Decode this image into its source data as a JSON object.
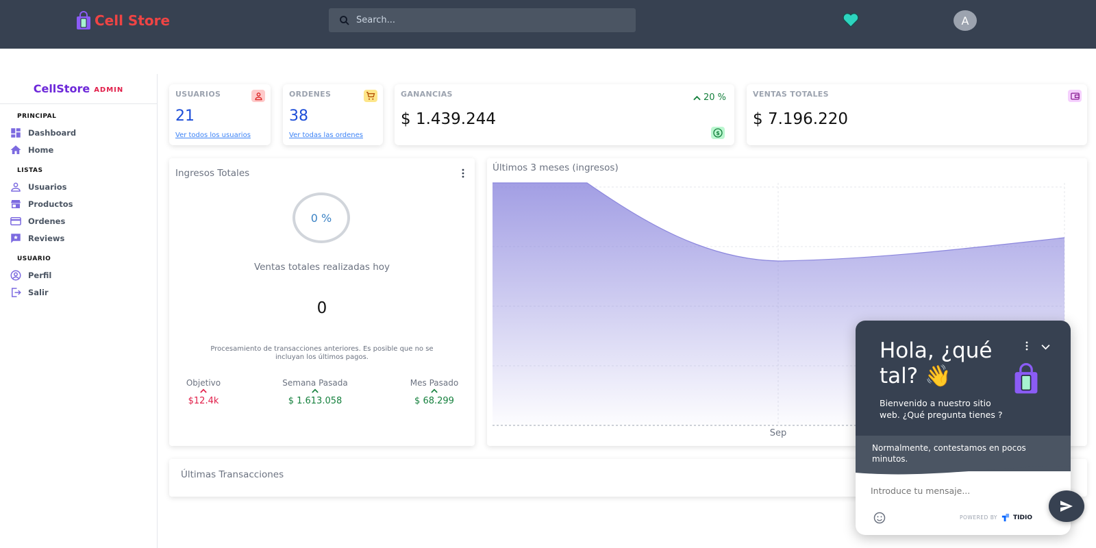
{
  "header": {
    "brand": "Cell Store",
    "search_placeholder": "Search...",
    "avatar_initial": "A"
  },
  "sidebar": {
    "title": "CellStore",
    "title_badge": "ADMIN",
    "sections": [
      {
        "label": "PRINCIPAL",
        "items": [
          {
            "label": "Dashboard",
            "icon": "dashboard-icon"
          },
          {
            "label": "Home",
            "icon": "home-icon"
          }
        ]
      },
      {
        "label": "LISTAS",
        "items": [
          {
            "label": "Usuarios",
            "icon": "user-icon"
          },
          {
            "label": "Productos",
            "icon": "store-icon"
          },
          {
            "label": "Ordenes",
            "icon": "credit-card-icon"
          },
          {
            "label": "Reviews",
            "icon": "review-icon"
          }
        ]
      },
      {
        "label": "USUARIO",
        "items": [
          {
            "label": "Perfil",
            "icon": "account-circle-icon"
          },
          {
            "label": "Salir",
            "icon": "logout-icon"
          }
        ]
      }
    ]
  },
  "stats": {
    "usuarios": {
      "label": "USUARIOS",
      "value": "21",
      "link": "Ver todos los usuarios"
    },
    "ordenes": {
      "label": "ORDENES",
      "value": "38",
      "link": "Ver todas las ordenes"
    },
    "ganancias": {
      "label": "GANANCIAS",
      "value": "$ 1.439.244",
      "percent": "20 %"
    },
    "ventas": {
      "label": "VENTAS TOTALES",
      "value": "$ 7.196.220"
    }
  },
  "ingresos": {
    "title": "Ingresos Totales",
    "ring_value": "0 %",
    "subtitle": "Ventas totales realizadas hoy",
    "amount": "0",
    "note_line1": "Procesamiento de transacciones anteriores. Es posible que no se",
    "note_line2": "incluyan los últimos pagos.",
    "columns": [
      {
        "label": "Objetivo",
        "value": "$12.4k",
        "trend": "up",
        "color": "#e11d48"
      },
      {
        "label": "Semana Pasada",
        "value": "$ 1.613.058",
        "trend": "up",
        "color": "#15803d"
      },
      {
        "label": "Mes Pasado",
        "value": "$ 68.299",
        "trend": "up",
        "color": "#15803d"
      }
    ]
  },
  "chart_data": {
    "type": "area",
    "title": "Últimos 3 meses (ingresos)",
    "x": [
      "",
      "Sep",
      ""
    ],
    "tick_labels": [
      "Sep"
    ],
    "grid": true,
    "fill_color": "#8b86dd"
  },
  "transacciones": {
    "title": "Últimas Transacciones"
  },
  "chat": {
    "greeting_line1": "Hola, ¿qué",
    "greeting_line2": "tal? 👋",
    "welcome_line1": "Bienvenido a nuestro sitio",
    "welcome_line2": "web. ¿Qué pregunta tienes ?",
    "response_line1": "Normalmente, contestamos en pocos",
    "response_line2": "minutos.",
    "input_placeholder": "Introduce tu mensaje...",
    "powered_by": "POWERED BY",
    "powered_brand": "TIDIO"
  }
}
